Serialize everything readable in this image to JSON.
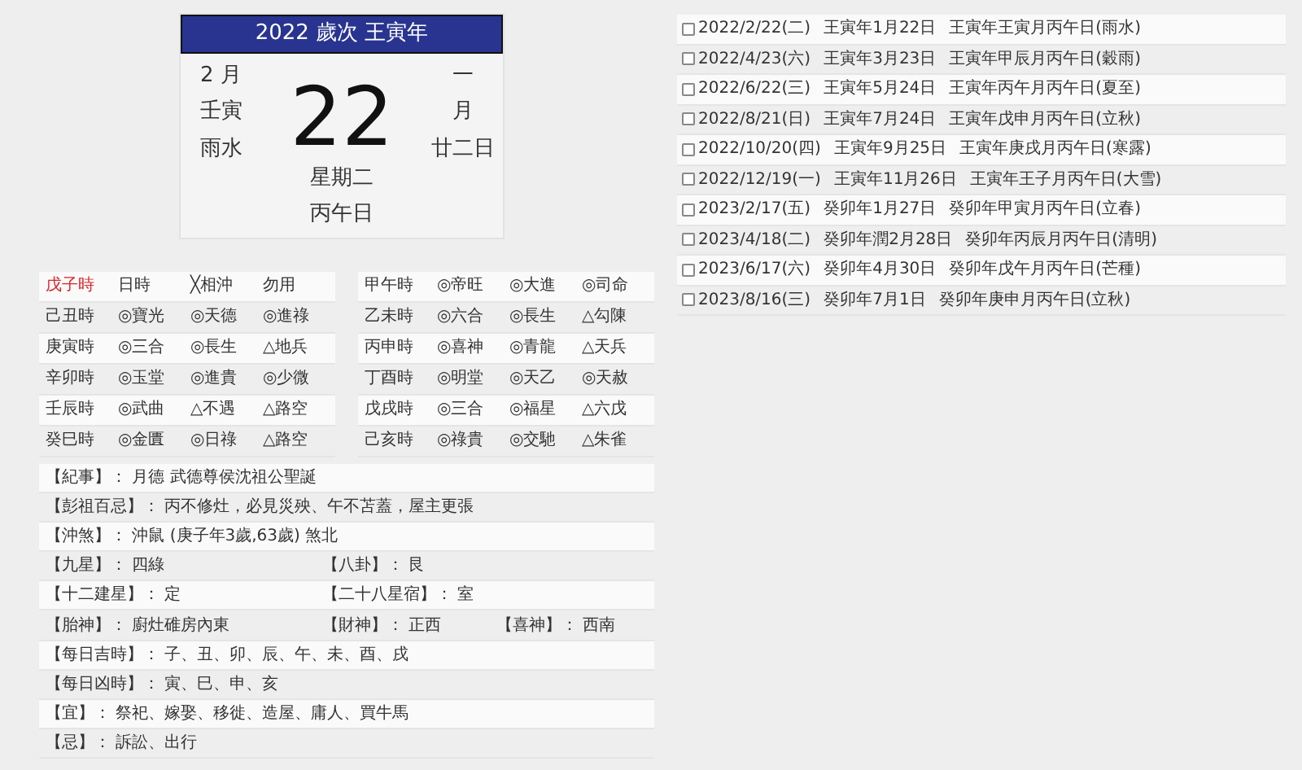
{
  "calendar": {
    "header": "2022 歲次 王寅年",
    "month": "2 月",
    "month_ganzhi": "壬寅",
    "solar_term": "雨水",
    "day": "22",
    "lunar_month_top": "一",
    "lunar_month_bottom": "月",
    "lunar_day": "廿二日",
    "weekday": "星期二",
    "day_ganzhi": "丙午日"
  },
  "hours_left": [
    {
      "hour": "戊子時",
      "current": true,
      "cells": [
        "日時",
        "╳相沖",
        "勿用"
      ]
    },
    {
      "hour": "己丑時",
      "current": false,
      "cells": [
        "◎寶光",
        "◎天德",
        "◎進祿"
      ]
    },
    {
      "hour": "庚寅時",
      "current": false,
      "cells": [
        "◎三合",
        "◎長生",
        "△地兵"
      ]
    },
    {
      "hour": "辛卯時",
      "current": false,
      "cells": [
        "◎玉堂",
        "◎進貴",
        "◎少微"
      ]
    },
    {
      "hour": "壬辰時",
      "current": false,
      "cells": [
        "◎武曲",
        "△不遇",
        "△路空"
      ]
    },
    {
      "hour": "癸巳時",
      "current": false,
      "cells": [
        "◎金匱",
        "◎日祿",
        "△路空"
      ]
    }
  ],
  "hours_right": [
    {
      "hour": "甲午時",
      "current": false,
      "cells": [
        "◎帝旺",
        "◎大進",
        "◎司命"
      ]
    },
    {
      "hour": "乙未時",
      "current": false,
      "cells": [
        "◎六合",
        "◎長生",
        "△勾陳"
      ]
    },
    {
      "hour": "丙申時",
      "current": false,
      "cells": [
        "◎喜神",
        "◎青龍",
        "△天兵"
      ]
    },
    {
      "hour": "丁酉時",
      "current": false,
      "cells": [
        "◎明堂",
        "◎天乙",
        "◎天赦"
      ]
    },
    {
      "hour": "戊戌時",
      "current": false,
      "cells": [
        "◎三合",
        "◎福星",
        "△六戊"
      ]
    },
    {
      "hour": "己亥時",
      "current": false,
      "cells": [
        "◎祿貴",
        "◎交馳",
        "△朱雀"
      ]
    }
  ],
  "info": [
    [
      {
        "label": "【紀事】",
        "value": "：  月德 武德尊侯沈祖公聖誕"
      }
    ],
    [
      {
        "label": "【彭祖百忌】",
        "value": "：  丙不修灶，必見災殃、午不苫蓋，屋主更張"
      }
    ],
    [
      {
        "label": "【沖煞】",
        "value": "：  沖鼠 (庚子年3歲,63歲) 煞北"
      }
    ],
    [
      {
        "label": "【九星】",
        "value": "：  四綠"
      },
      {
        "label": "【八卦】",
        "value": "：  艮"
      }
    ],
    [
      {
        "label": "【十二建星】",
        "value": "：  定"
      },
      {
        "label": "【二十八星宿】",
        "value": "：  室"
      }
    ],
    [
      {
        "label": "【胎神】",
        "value": "：  廚灶碓房內東"
      },
      {
        "label": "【財神】",
        "value": "：  正西"
      },
      {
        "label": "【喜神】",
        "value": "：  西南"
      }
    ],
    [
      {
        "label": "【每日吉時】",
        "value": "：  子、丑、卯、辰、午、未、酉、戌"
      }
    ],
    [
      {
        "label": "【每日凶時】",
        "value": "：  寅、巳、申、亥"
      }
    ],
    [
      {
        "label": "【宜】",
        "value": "：  祭祀、嫁娶、移徙、造屋、庸人、買牛馬"
      }
    ],
    [
      {
        "label": "【忌】",
        "value": "：  訴訟、出行"
      }
    ]
  ],
  "dates": [
    {
      "checked": false,
      "date": "2022/2/22(二)",
      "lunar": "王寅年1月22日",
      "ganzhi": "王寅年王寅月丙午日(雨水)"
    },
    {
      "checked": false,
      "date": "2022/4/23(六)",
      "lunar": "王寅年3月23日",
      "ganzhi": "王寅年甲辰月丙午日(穀雨)"
    },
    {
      "checked": false,
      "date": "2022/6/22(三)",
      "lunar": "王寅年5月24日",
      "ganzhi": "王寅年丙午月丙午日(夏至)"
    },
    {
      "checked": false,
      "date": "2022/8/21(日)",
      "lunar": "王寅年7月24日",
      "ganzhi": "王寅年戊申月丙午日(立秋)"
    },
    {
      "checked": false,
      "date": "2022/10/20(四)",
      "lunar": "王寅年9月25日",
      "ganzhi": "王寅年庚戌月丙午日(寒露)"
    },
    {
      "checked": false,
      "date": "2022/12/19(一)",
      "lunar": "王寅年11月26日",
      "ganzhi": "王寅年王子月丙午日(大雪)"
    },
    {
      "checked": false,
      "date": "2023/2/17(五)",
      "lunar": "癸卯年1月27日",
      "ganzhi": "癸卯年甲寅月丙午日(立春)"
    },
    {
      "checked": false,
      "date": "2023/4/18(二)",
      "lunar": "癸卯年潤2月28日",
      "ganzhi": "癸卯年丙辰月丙午日(清明)"
    },
    {
      "checked": false,
      "date": "2023/6/17(六)",
      "lunar": "癸卯年4月30日",
      "ganzhi": "癸卯年戊午月丙午日(芒種)"
    },
    {
      "checked": false,
      "date": "2023/8/16(三)",
      "lunar": "癸卯年7月1日",
      "ganzhi": "癸卯年庚申月丙午日(立秋)"
    }
  ]
}
